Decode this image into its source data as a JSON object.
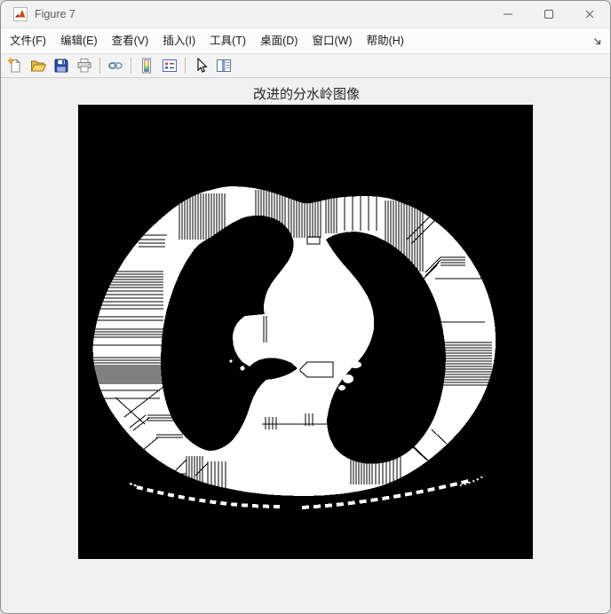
{
  "window": {
    "title": "Figure 7",
    "controls": [
      {
        "name": "minimize"
      },
      {
        "name": "maximize"
      },
      {
        "name": "close"
      }
    ]
  },
  "menu": {
    "items": [
      "文件(F)",
      "编辑(E)",
      "查看(V)",
      "插入(I)",
      "工具(T)",
      "桌面(D)",
      "窗口(W)",
      "帮助(H)"
    ],
    "overflow_icon": "dock-arrow"
  },
  "toolbar": {
    "icons": [
      {
        "name": "new-figure"
      },
      {
        "name": "open-file"
      },
      {
        "name": "save-figure"
      },
      {
        "name": "print-figure"
      },
      {
        "name": "link-plot"
      },
      {
        "name": "insert-colorbar"
      },
      {
        "name": "insert-legend"
      },
      {
        "name": "edit-plot"
      },
      {
        "name": "open-property-inspector"
      }
    ]
  },
  "figure": {
    "title": "改进的分水岭图像",
    "image_description": "Binary (black and white) improved watershed segmentation image of a chest CT slice"
  }
}
